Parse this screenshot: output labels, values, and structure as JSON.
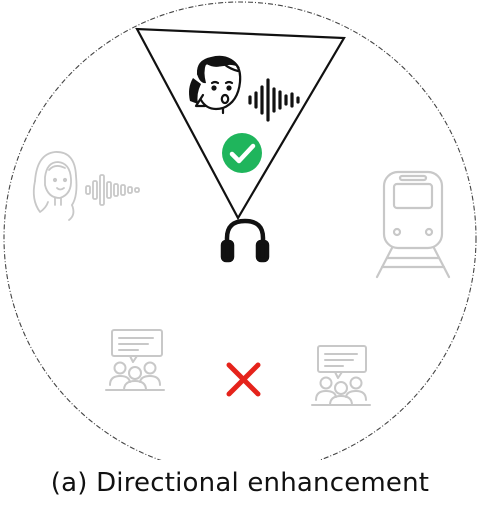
{
  "caption": "(a) Directional enhancement",
  "icons": {
    "target_speaker": "woman-speaking-icon",
    "target_audio": "sound-wave-icon",
    "accepted": "check-icon",
    "listener": "headphones-icon",
    "left_speaker": "woman-icon",
    "left_audio": "sound-wave-icon",
    "train": "train-icon",
    "group_left": "group-chat-icon",
    "group_right": "group-chat-icon",
    "rejected": "cross-icon"
  },
  "colors": {
    "check": "#1fb55c",
    "cross": "#e5231b",
    "active": "#111111",
    "faded": "#c8c8c8"
  }
}
